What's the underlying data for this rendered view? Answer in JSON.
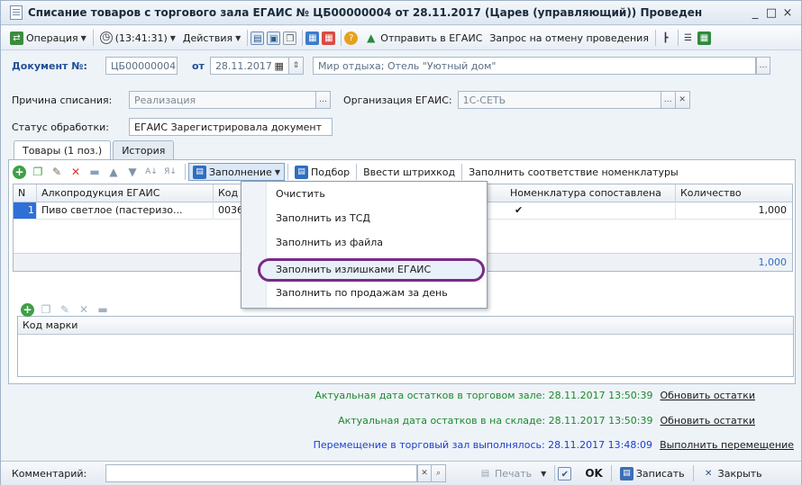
{
  "window": {
    "title": "Списание товаров с торгового зала ЕГАИС № ЦБ00000004 от 28.11.2017 (Царев (управляющий)) Проведен",
    "minimize": "_",
    "maximize": "□",
    "close": "×"
  },
  "commandbar": {
    "operation": "Операция",
    "time": "(13:41:31)",
    "actions": "Действия",
    "send_egais": "Отправить в ЕГАИС",
    "cancel_request": "Запрос на отмену проведения"
  },
  "header": {
    "doc_no_label": "Документ №:",
    "doc_no": "ЦБ00000004",
    "date_label": "от",
    "date": "28.11.2017",
    "location": "Мир отдыха; Отель \"Уютный дом\"",
    "reason_label": "Причина списания:",
    "reason": "Реализация",
    "org_label": "Организация ЕГАИС:",
    "org": "1С-СЕТЬ",
    "status_label": "Статус обработки:",
    "status": "ЕГАИС Зарегистрировала документ"
  },
  "tabs": [
    "Товары (1 поз.)",
    "История"
  ],
  "goods_toolbar": {
    "fill": "Заполнение",
    "pick": "Подбор",
    "barcode": "Ввести штрихкод",
    "match": "Заполнить соответствие номенклатуры"
  },
  "grid": {
    "columns": [
      "N",
      "Алкопродукция ЕГАИС",
      "Код пр",
      "Номенклатура сопоставлена",
      "Количество"
    ],
    "rows": [
      {
        "n": "1",
        "product": "Пиво светлое (пастеризо...",
        "code": "00363",
        "matched": "✔",
        "qty": "1,000"
      }
    ],
    "total_qty": "1,000"
  },
  "menu": {
    "items": [
      "Очистить",
      "Заполнить из ТСД",
      "Заполнить из файла",
      "Заполнить излишками ЕГАИС",
      "Заполнить по продажам за день"
    ]
  },
  "marks_grid": {
    "column": "Код марки"
  },
  "info": {
    "line1": "Актуальная дата остатков в торговом зале: 28.11.2017 13:50:39",
    "line1_link": "Обновить остатки",
    "line2": "Актуальная дата остатков в на складе: 28.11.2017 13:50:39",
    "line2_link": "Обновить остатки",
    "line3": "Перемещение в торговый зал выполнялось: 28.11.2017 13:48:09",
    "line3_link": "Выполнить перемещение"
  },
  "bottom": {
    "comment_label": "Комментарий:",
    "print": "Печать",
    "ok": "OK",
    "save": "Записать",
    "close": "Закрыть"
  },
  "colors": {
    "accent_blue": "#2f6fd8",
    "highlight_ring": "#7a2a86",
    "info_green": "#1c8a2c",
    "info_blue": "#1b3fcf"
  }
}
